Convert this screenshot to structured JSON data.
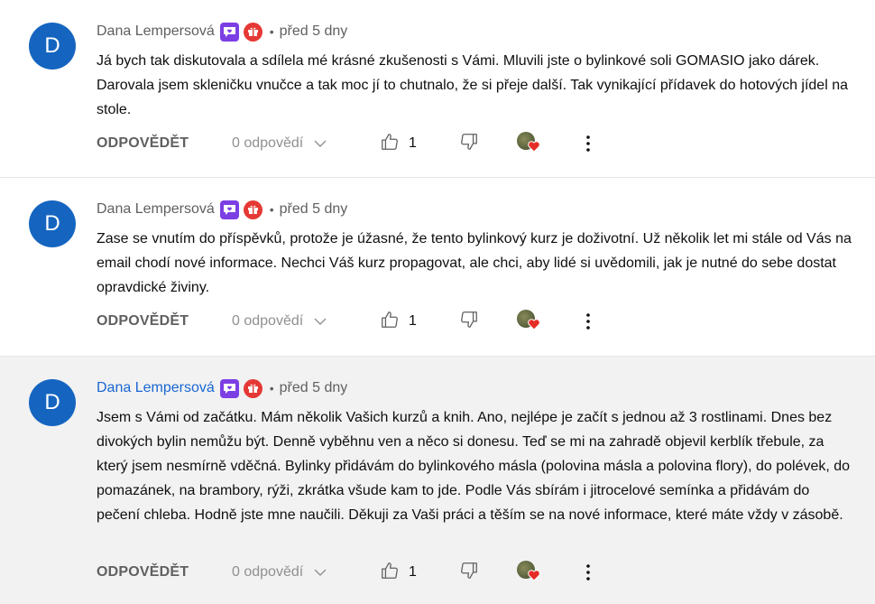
{
  "comments": [
    {
      "avatar_letter": "D",
      "author": "Dana Lempersová",
      "separator": "•",
      "time": "před 5 dny",
      "text": "Já bych tak diskutovala a sdílela mé krásné zkušenosti s Vámi. Mluvili jste o bylinkové soli GOMASIO jako dárek. Darovala jsem skleničku vnučce a tak moc jí to chutnalo, že si přeje další. Tak vynikající přídavek do hotových jídel na stole.",
      "reply_label": "ODPOVĚDĚT",
      "replies_label": "0 odpovědí",
      "likes": "1"
    },
    {
      "avatar_letter": "D",
      "author": "Dana Lempersová",
      "separator": "•",
      "time": "před 5 dny",
      "text": "Zase se vnutím do příspěvků, protože je úžasné, že tento bylinkový kurz je doživotní. Už několik let mi stále od Vás na email chodí nové informace. Nechci Váš kurz propagovat, ale chci, aby lidé si uvědomili, jak je nutné do sebe dostat opravdické živiny.",
      "reply_label": "ODPOVĚDĚT",
      "replies_label": "0 odpovědí",
      "likes": "1"
    },
    {
      "avatar_letter": "D",
      "author": "Dana Lempersová",
      "separator": "•",
      "time": "před 5 dny",
      "text": "Jsem s Vámi od začátku. Mám několik Vašich kurzů a knih. Ano, nejlépe je začít s jednou až 3 rostlinami. Dnes bez divokých bylin nemůžu být. Denně vyběhnu ven a něco si donesu. Teď se mi na zahradě objevil kerblík třebule, za který jsem nesmírně vděčná. Bylinky přidávám do bylinkového másla (polovina másla a polovina flory), do polévek, do pomazánek, na brambory, rýži, zkrátka všude kam to jde. Podle Vás sbírám i jitrocelové semínka a přidávám do pečení chleba. Hodně jste mne naučili. Děkuji za Vaši práci a těším se na nové informace, které máte vždy v zásobě.",
      "reply_label": "ODPOVĚDĚT",
      "replies_label": "0 odpovědí",
      "likes": "1"
    }
  ],
  "colors": {
    "avatar": "#1565c0",
    "member_badge": "#7b3fe4",
    "live_badge": "#e53935",
    "highlight_author": "#1967d2",
    "highlight_bg": "#f2f2f2"
  },
  "icons": [
    "member-badge-icon",
    "gift-badge-icon",
    "thumb-up-icon",
    "thumb-down-icon",
    "heart-icon",
    "chevron-down-icon",
    "more-vert-icon"
  ]
}
